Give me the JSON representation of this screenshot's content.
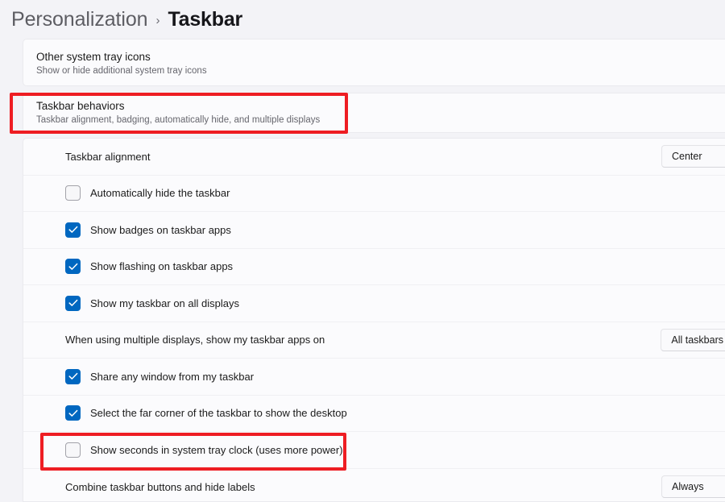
{
  "breadcrumb": {
    "parent": "Personalization",
    "separator": "›",
    "current": "Taskbar"
  },
  "sections": {
    "other_tray_icons": {
      "title": "Other system tray icons",
      "subtitle": "Show or hide additional system tray icons",
      "expand_icon": "chevron-down-icon"
    },
    "taskbar_behaviors": {
      "title": "Taskbar behaviors",
      "subtitle": "Taskbar alignment, badging, automatically hide, and multiple displays",
      "expand_icon": "chevron-up-icon"
    }
  },
  "settings": [
    {
      "type": "dropdown",
      "label": "Taskbar alignment",
      "value": "Center"
    },
    {
      "type": "checkbox",
      "label": "Automatically hide the taskbar",
      "checked": false
    },
    {
      "type": "checkbox",
      "label": "Show badges on taskbar apps",
      "checked": true
    },
    {
      "type": "checkbox",
      "label": "Show flashing on taskbar apps",
      "checked": true
    },
    {
      "type": "checkbox",
      "label": "Show my taskbar on all displays",
      "checked": true
    },
    {
      "type": "dropdown",
      "label": "When using multiple displays, show my taskbar apps on",
      "value": "All taskbars"
    },
    {
      "type": "checkbox",
      "label": "Share any window from my taskbar",
      "checked": true
    },
    {
      "type": "checkbox",
      "label": "Select the far corner of the taskbar to show the desktop",
      "checked": true
    },
    {
      "type": "checkbox",
      "label": "Show seconds in system tray clock (uses more power)",
      "checked": false
    },
    {
      "type": "dropdown",
      "label": "Combine taskbar buttons and hide labels",
      "value": "Always"
    }
  ],
  "annotations": [
    {
      "name": "taskbar-behaviors-highlight",
      "color": "#ee1d23"
    },
    {
      "name": "show-seconds-highlight",
      "color": "#ee1d23"
    }
  ],
  "colors": {
    "accent": "#0067c0",
    "page_background": "#f3f3f7",
    "card_background": "#fbfbfd",
    "annotation": "#ee1d23"
  }
}
